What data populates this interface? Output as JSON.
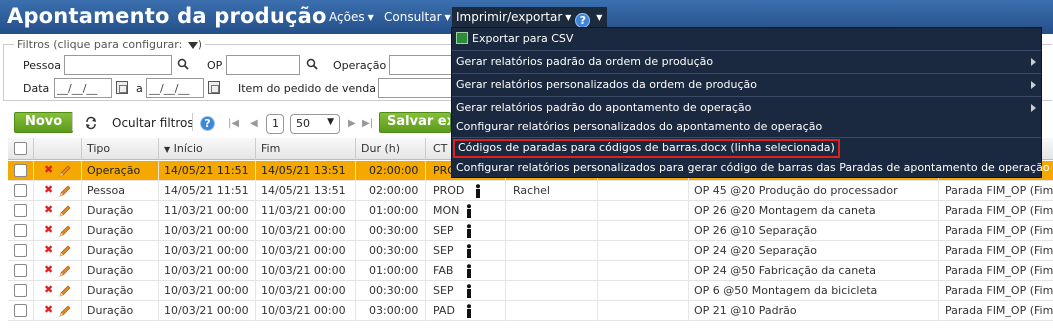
{
  "header": {
    "title": "Apontamento da produção",
    "menus": [
      "Ações",
      "Consultar",
      "Imprimir/exportar"
    ]
  },
  "filters": {
    "legend": "Filtros (clique para configurar:",
    "pessoa_label": "Pessoa",
    "op_label": "OP",
    "operacao_label": "Operação",
    "data_label": "Data",
    "date_from": "__/__/__",
    "a_label": "a",
    "date_to": "__/__/__",
    "item_label": "Item do pedido de venda"
  },
  "toolbar": {
    "novo": "Novo",
    "ocultar_filtros": "Ocultar filtros",
    "page": "1",
    "page_size": "50",
    "salvar": "Salvar ex"
  },
  "table": {
    "headers": [
      "Tipo",
      "Início",
      "Fim",
      "Dur (h)",
      "CT"
    ],
    "rows": [
      {
        "tipo": "Operação",
        "inicio": "14/05/21 11:51",
        "fim": "14/05/21 13:51",
        "dur": "02:00:00",
        "ct": "PRO",
        "pessoa": "",
        "op": "",
        "parada": "",
        "selected": true
      },
      {
        "tipo": "Pessoa",
        "inicio": "14/05/21 11:51",
        "fim": "14/05/21 13:51",
        "dur": "02:00:00",
        "ct": "PROD",
        "pessoa": "Rachel",
        "op": "OP 45 @20 Produção do processador",
        "parada": "Parada FIM_OP (Fim"
      },
      {
        "tipo": "Duração",
        "inicio": "11/03/21 00:00",
        "fim": "11/03/21 00:00",
        "dur": "01:00:00",
        "ct": "MON",
        "pessoa": "",
        "op": "OP 26 @20 Montagem da caneta",
        "parada": "Parada FIM_OP (Fim"
      },
      {
        "tipo": "Duração",
        "inicio": "10/03/21 00:00",
        "fim": "10/03/21 00:00",
        "dur": "00:30:00",
        "ct": "SEP",
        "pessoa": "",
        "op": "OP 26 @10 Separação",
        "parada": "Parada FIM_OP (Fim"
      },
      {
        "tipo": "Duração",
        "inicio": "10/03/21 00:00",
        "fim": "10/03/21 00:00",
        "dur": "00:30:00",
        "ct": "SEP",
        "pessoa": "",
        "op": "OP 24 @20 Separação",
        "parada": "Parada FIM_OP (Fim"
      },
      {
        "tipo": "Duração",
        "inicio": "10/03/21 00:00",
        "fim": "10/03/21 00:00",
        "dur": "01:00:00",
        "ct": "FAB",
        "pessoa": "",
        "op": "OP 24 @50 Fabricação da caneta",
        "parada": "Parada FIM_OP (Fim"
      },
      {
        "tipo": "Duração",
        "inicio": "10/03/21 00:00",
        "fim": "10/03/21 00:00",
        "dur": "00:30:00",
        "ct": "SEP",
        "pessoa": "",
        "op": "OP 6 @50 Montagem da bicicleta",
        "parada": "Parada FIM_OP (Fim"
      },
      {
        "tipo": "Duração",
        "inicio": "10/03/21 00:00",
        "fim": "10/03/21 00:00",
        "dur": "03:00:00",
        "ct": "PAD",
        "pessoa": "",
        "op": "OP 21 @10 Padrão",
        "parada": "Parada FIM_OP (Fim"
      }
    ]
  },
  "menu": {
    "items": [
      "Exportar para CSV",
      "Gerar relatórios padrão da ordem de produção",
      "Gerar relatórios personalizados da ordem de produção",
      "Gerar relatórios padrão do apontamento de operação",
      "Configurar relatórios personalizados do apontamento de operação",
      "Códigos de paradas para códigos de barras.docx (linha selecionada)",
      "Configurar relatórios personalizados para gerar código de barras das Paradas de apontamento de operação"
    ]
  },
  "colors": {
    "header": "#2f5f9e",
    "menu_bg": "#1b2940",
    "selected_row": "#f5a800",
    "green_button": "#6aa424",
    "highlight_border": "#e02020"
  }
}
